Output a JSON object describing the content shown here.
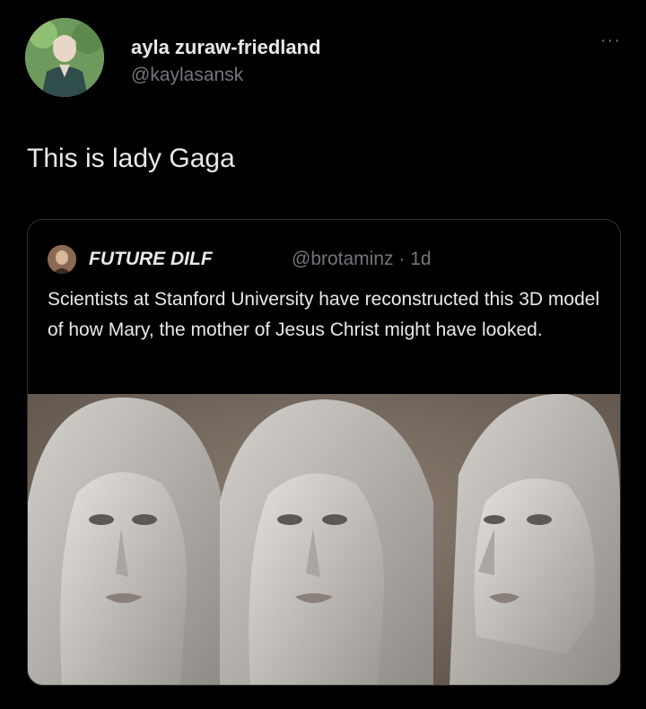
{
  "tweet": {
    "author_name": "ayla zuraw-friedland",
    "author_handle": "@kaylasansk",
    "more_icon": "more-icon",
    "text": "This is lady Gaga"
  },
  "quoted": {
    "author_name": "FUTURE DILF",
    "author_handle": "@brotaminz",
    "time": "· 1d",
    "text": "Scientists at Stanford University have reconstructed this 3D model of how Mary, the mother of Jesus Christ might have looked.",
    "media_icon": "sculpture-image"
  },
  "colors": {
    "background": "#000000",
    "text": "#e7e9ea",
    "muted": "#71767b",
    "border": "#2f3336"
  }
}
